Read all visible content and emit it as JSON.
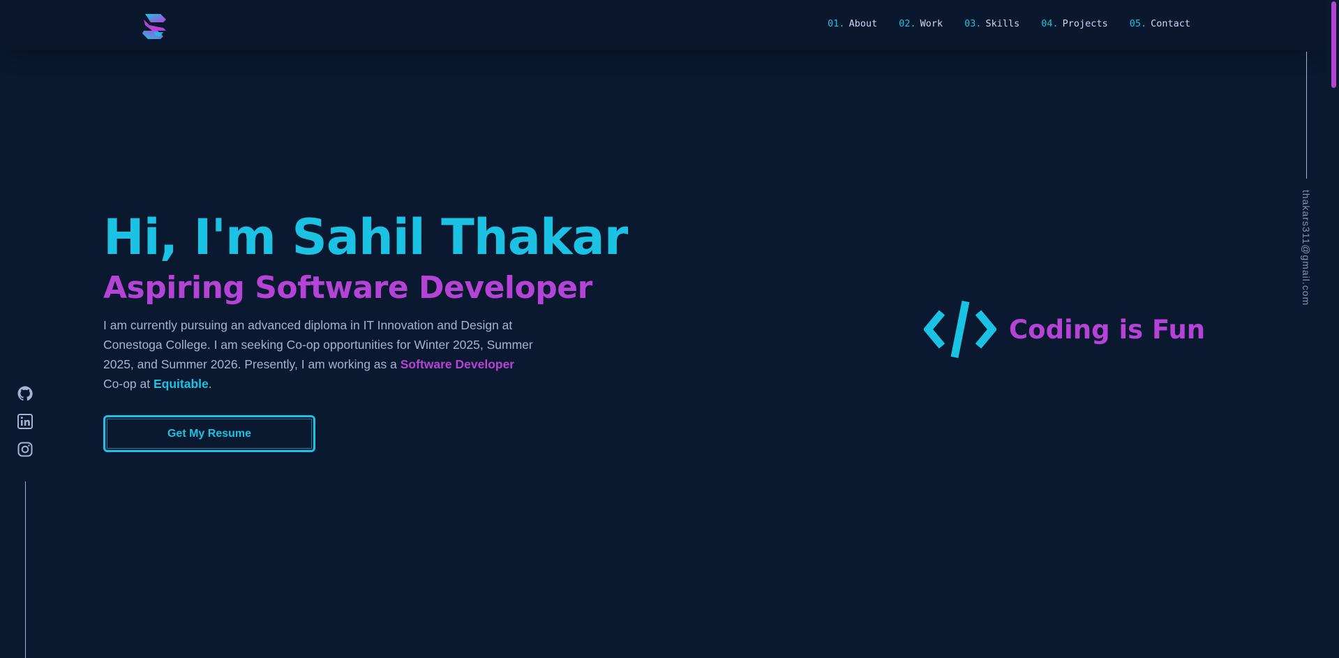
{
  "nav": {
    "items": [
      {
        "num": "01.",
        "label": "About"
      },
      {
        "num": "02.",
        "label": "Work"
      },
      {
        "num": "03.",
        "label": "Skills"
      },
      {
        "num": "04.",
        "label": "Projects"
      },
      {
        "num": "05.",
        "label": "Contact"
      }
    ]
  },
  "hero": {
    "title": "Hi, I'm Sahil Thakar",
    "subtitle": "Aspiring Software Developer",
    "desc_part1": "I am currently pursuing an advanced diploma in IT Innovation and Design at Conestoga College. I am seeking Co-op opportunities for Winter 2025, Summer 2025, and Summer 2026. Presently, I am working as a ",
    "desc_role": "Software Developer",
    "desc_part2": " Co-op at ",
    "desc_company": "Equitable",
    "desc_part3": ".",
    "resume_button": "Get My Resume"
  },
  "graphic": {
    "text": "Coding is Fun",
    "icon": "code-slash-icon"
  },
  "socials": [
    "github-icon",
    "linkedin-icon",
    "instagram-icon"
  ],
  "email": "thakars311@gmail.com",
  "colors": {
    "background": "#0a192f",
    "accent_cyan": "#1bc2e3",
    "accent_purple": "#b544d6",
    "text_muted": "#a8b2d1"
  }
}
